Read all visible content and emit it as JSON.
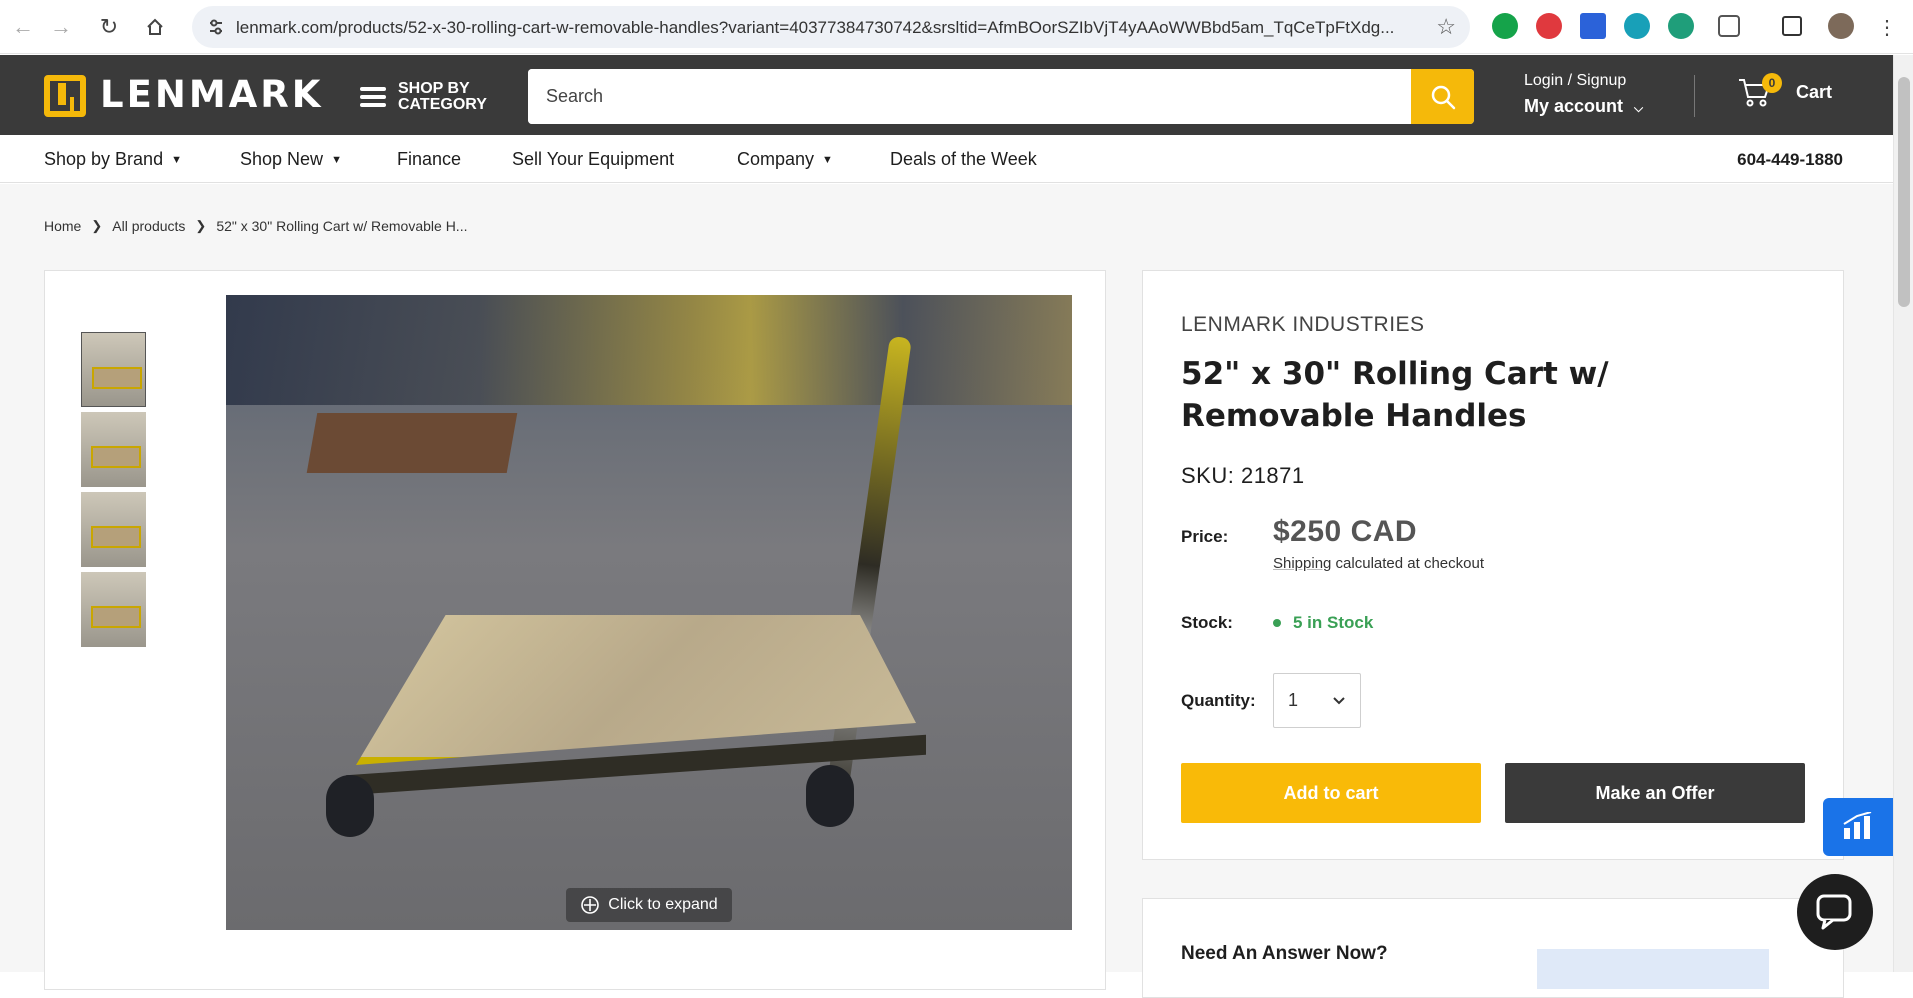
{
  "browser": {
    "url": "lenmark.com/products/52-x-30-rolling-cart-w-removable-handles?variant=40377384730742&srsltid=AfmBOorSZIbVjT4yAAoWWBbd5am_TqCeTpFtXdg..."
  },
  "header": {
    "logo": "LENMARK",
    "category_button": "SHOP BY CATEGORY",
    "search_placeholder": "Search",
    "account_line1": "Login / Signup",
    "account_line2": "My account",
    "cart_label": "Cart",
    "cart_count": "0"
  },
  "nav": {
    "items": [
      "Shop by Brand",
      "Shop New",
      "Finance",
      "Sell Your Equipment",
      "Company",
      "Deals of the Week"
    ],
    "phone": "604-449-1880"
  },
  "breadcrumb": [
    "Home",
    "All products",
    "52\" x 30\" Rolling Cart w/ Removable H..."
  ],
  "gallery": {
    "expand_label": "Click to expand"
  },
  "product": {
    "vendor": "LENMARK INDUSTRIES",
    "title": "52\" x 30\" Rolling Cart w/ Removable Handles",
    "sku": "SKU: 21871",
    "price_label": "Price:",
    "price": "$250 CAD",
    "shipping_link": "Shipping",
    "shipping_rest": " calculated at checkout",
    "stock_label": "Stock:",
    "stock": "5 in Stock",
    "quantity_label": "Quantity:",
    "quantity": "1",
    "add_to_cart": "Add to cart",
    "make_offer": "Make an Offer"
  },
  "answer": {
    "title": "Need An Answer Now?"
  },
  "colors": {
    "brand_yellow": "#f5b90a",
    "header_dark": "#3a3a3a",
    "stock_green": "#3aa055"
  }
}
